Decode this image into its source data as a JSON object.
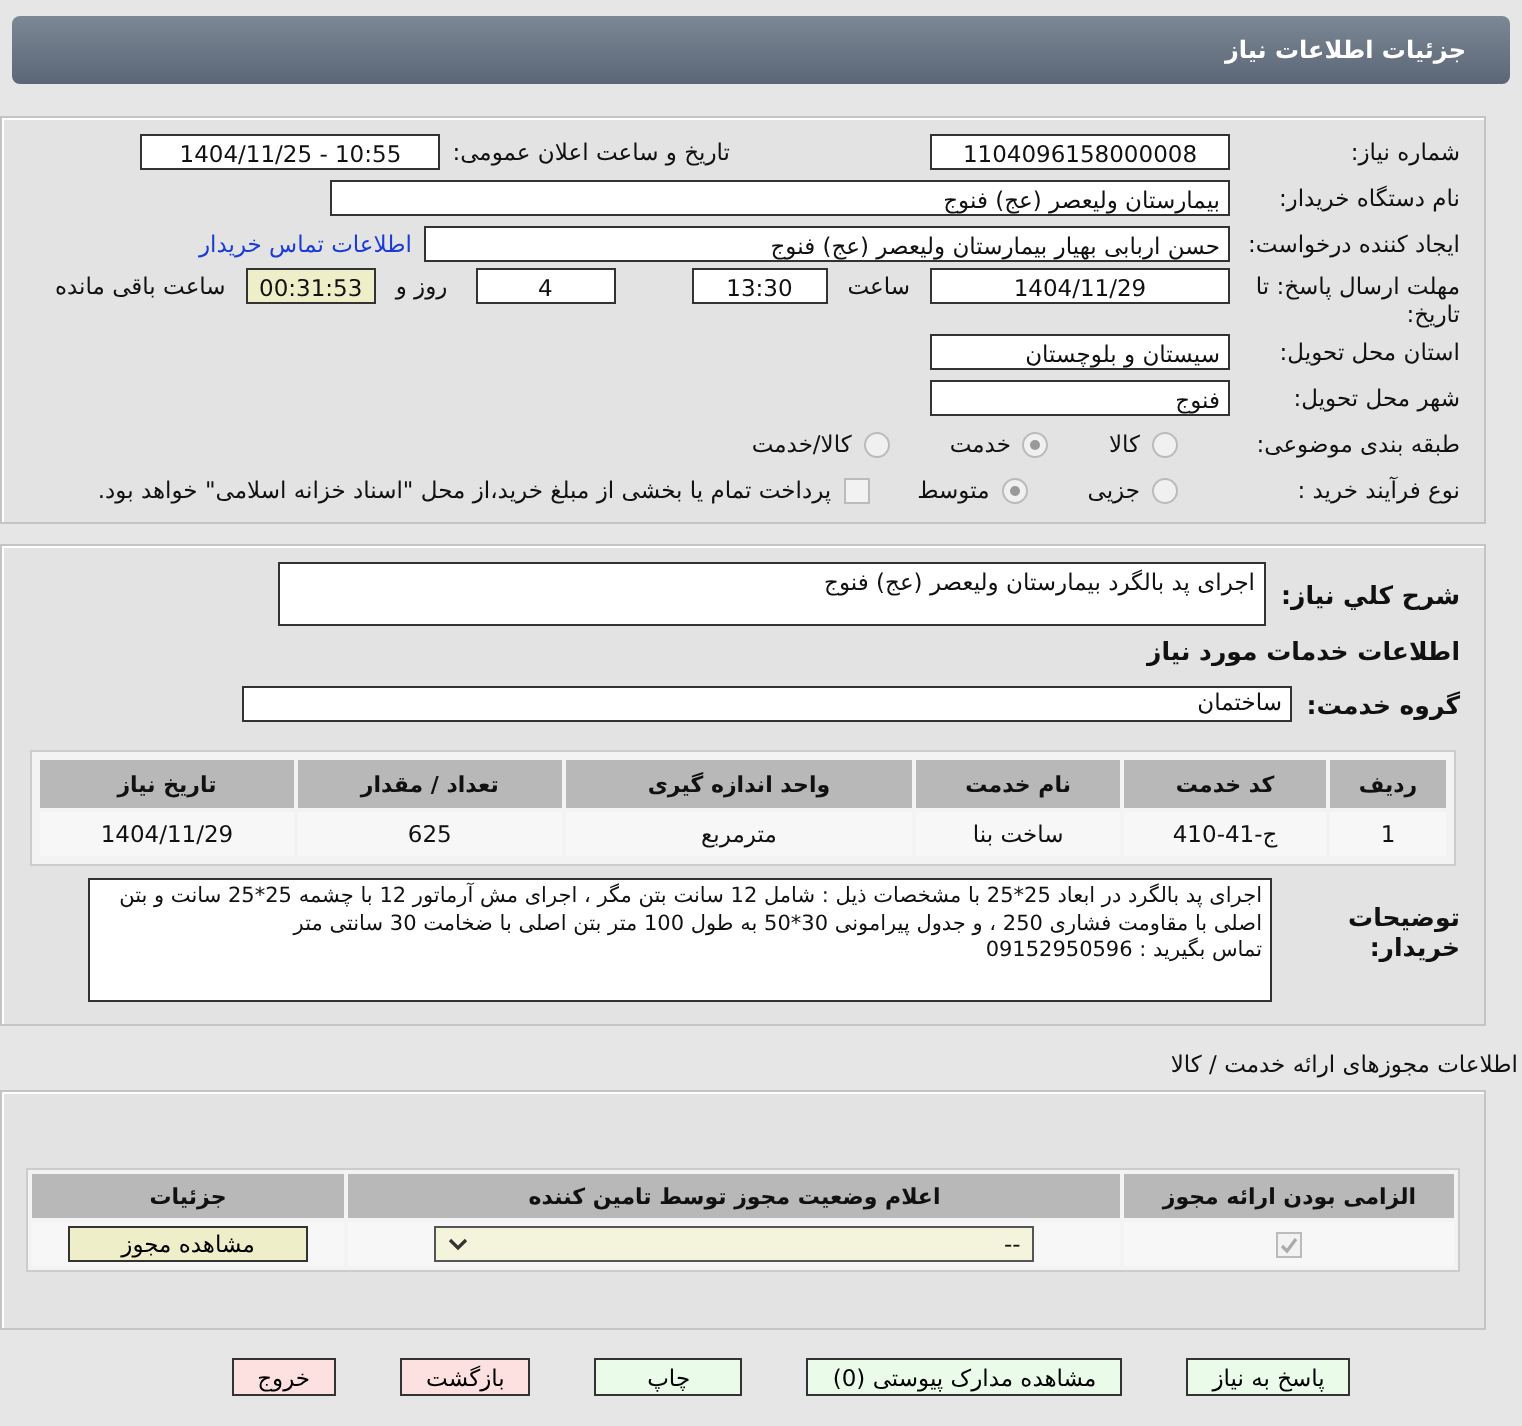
{
  "header": {
    "title": "جزئیات اطلاعات نیاز"
  },
  "need_number": {
    "label": "شماره نیاز:",
    "value": "1104096158000008"
  },
  "announce": {
    "label": "تاریخ و ساعت اعلان عمومی:",
    "value": "1404/11/25 - 10:55"
  },
  "buyer_org": {
    "label": "نام دستگاه خریدار:",
    "value": "بیمارستان ولیعصر (عج) فنوج"
  },
  "requester": {
    "label": "ایجاد کننده درخواست:",
    "value": "حسن اربابی بهیار بیمارستان ولیعصر (عج) فنوج",
    "link": "اطلاعات تماس خریدار"
  },
  "deadline": {
    "label": "مهلت ارسال پاسخ: تا تاریخ:",
    "date": "1404/11/29",
    "time_label": "ساعت",
    "time": "13:30",
    "days": "4",
    "days_label": "روز و",
    "remaining": "00:31:53",
    "remaining_label": "ساعت باقی مانده"
  },
  "province": {
    "label": "استان محل تحویل:",
    "value": "سیستان و بلوچستان"
  },
  "city": {
    "label": "شهر محل تحویل:",
    "value": "فنوج"
  },
  "category": {
    "label": "طبقه بندی موضوعی:",
    "options": [
      {
        "label": "کالا",
        "selected": false
      },
      {
        "label": "خدمت",
        "selected": true
      },
      {
        "label": "کالا/خدمت",
        "selected": false
      }
    ]
  },
  "process": {
    "label": "نوع فرآیند خرید :",
    "options": [
      {
        "label": "جزیی",
        "selected": false
      },
      {
        "label": "متوسط",
        "selected": true
      }
    ],
    "payment": {
      "label": "پرداخت تمام یا بخشی از مبلغ خرید،از محل \"اسناد خزانه اسلامی\" خواهد بود.",
      "checked": false
    }
  },
  "summary": {
    "label": "شرح کلي نیاز:",
    "value": "اجرای پد بالگرد بیمارستان ولیعصر (عج) فنوج"
  },
  "services_title": "اطلاعات خدمات مورد نیاز",
  "service_group": {
    "label": "گروه خدمت:",
    "value": "ساختمان"
  },
  "services_table": {
    "columns": [
      "ردیف",
      "کد خدمت",
      "نام خدمت",
      "واحد اندازه گیری",
      "تعداد / مقدار",
      "تاریخ نیاز"
    ],
    "rows": [
      [
        "1",
        "ج-41-410",
        "ساخت بنا",
        "مترمربع",
        "625",
        "1404/11/29"
      ]
    ]
  },
  "buyer_notes": {
    "label": "توضیحات خریدار:",
    "text": "اجرای پد بالگرد در ابعاد 25*25 با مشخصات ذیل : شامل 12 سانت بتن مگر ، اجرای مش آرماتور 12 با چشمه 25*25 سانت و بتن اصلی با مقاومت فشاری 250 ، و جدول پیرامونی 30*50 به طول 100 متر بتن اصلی با ضخامت 30 سانتی متر\nتماس بگیرید : 09152950596"
  },
  "licenses_title": "اطلاعات مجوزهای ارائه خدمت / کالا",
  "licenses_table": {
    "columns": [
      "الزامی بودن ارائه مجوز",
      "اعلام وضعیت مجوز توسط تامین کننده",
      "جزئیات"
    ],
    "rows": [
      {
        "required": true,
        "status": "--",
        "action": "مشاهده مجوز"
      }
    ]
  },
  "buttons": [
    {
      "label": "پاسخ به نیاز",
      "kind": "normal"
    },
    {
      "label": "مشاهده مدارک پیوستی (0)",
      "kind": "normal"
    },
    {
      "label": "چاپ",
      "kind": "normal"
    },
    {
      "label": "بازگشت",
      "kind": "danger"
    },
    {
      "label": "خروج",
      "kind": "danger"
    }
  ]
}
